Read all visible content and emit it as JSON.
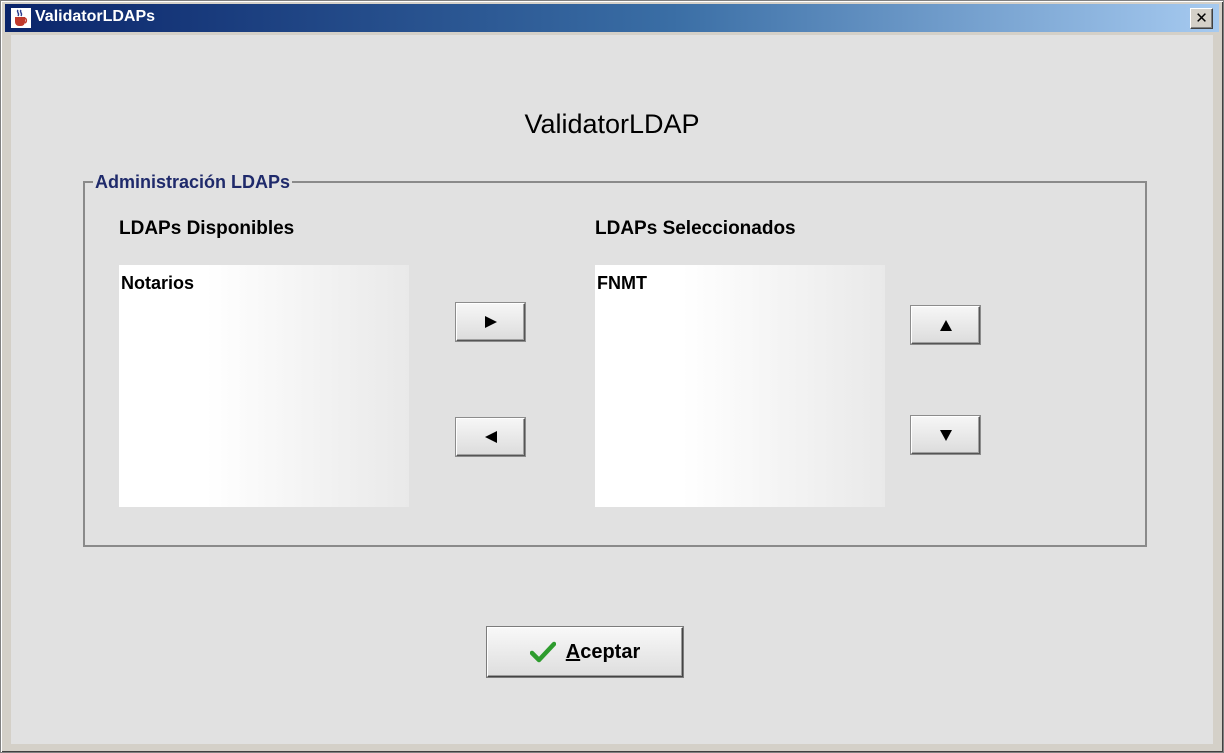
{
  "window": {
    "title": "ValidatorLDAPs",
    "close_symbol": "✕",
    "app_icon": "java-cup-icon"
  },
  "main": {
    "heading": "ValidatorLDAP",
    "group": {
      "legend": "Administración LDAPs",
      "available": {
        "label": "LDAPs Disponibles",
        "items": [
          "Notarios"
        ]
      },
      "selected": {
        "label": "LDAPs Seleccionados",
        "items": [
          "FNMT"
        ]
      },
      "transfer_buttons": [
        "arrow-right-icon",
        "arrow-left-icon"
      ],
      "order_buttons": [
        "arrow-up-icon",
        "arrow-down-icon"
      ]
    }
  },
  "footer": {
    "accept_mnemonic": "A",
    "accept_rest": "ceptar",
    "accept_icon": "checkmark-icon",
    "accept_icon_color": "#2e9c2e"
  }
}
